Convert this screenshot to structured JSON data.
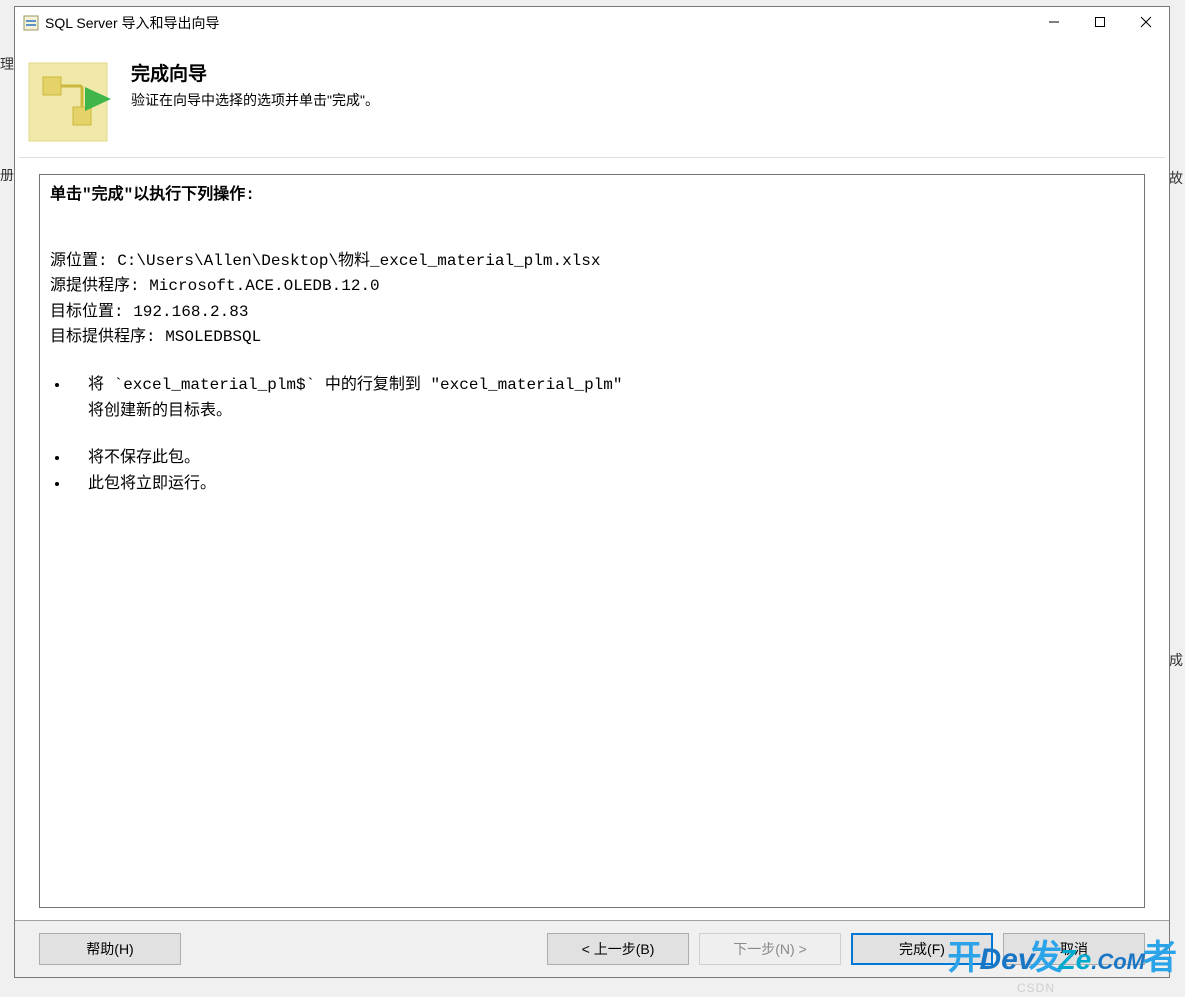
{
  "window": {
    "title": "SQL Server 导入和导出向导"
  },
  "header": {
    "title": "完成向导",
    "subtitle": "验证在向导中选择的选项并单击\"完成\"。"
  },
  "summary": {
    "heading": "单击\"完成\"以执行下列操作:",
    "lines": [
      "源位置: C:\\Users\\Allen\\Desktop\\物料_excel_material_plm.xlsx",
      "源提供程序: Microsoft.ACE.OLEDB.12.0",
      "目标位置: 192.168.2.83",
      "目标提供程序: MSOLEDBSQL"
    ],
    "bullet1": "将 `excel_material_plm$` 中的行复制到 \"excel_material_plm\"",
    "bullet1_sub": "将创建新的目标表。",
    "bullet2": "将不保存此包。",
    "bullet3": "此包将立即运行。"
  },
  "buttons": {
    "help": "帮助(H)",
    "back": "< 上一步(B)",
    "next": "下一步(N) >",
    "finish": "完成(F)",
    "cancel": "取消"
  },
  "bg": {
    "l1": "理",
    "l2": "册",
    "r1": "故",
    "r2": "成"
  },
  "watermark": {
    "cn1": "开",
    "dev": "Dev",
    "ze": "Ze",
    "com": ".CoM",
    "cn2": "者",
    "csdn": "CSDN"
  }
}
